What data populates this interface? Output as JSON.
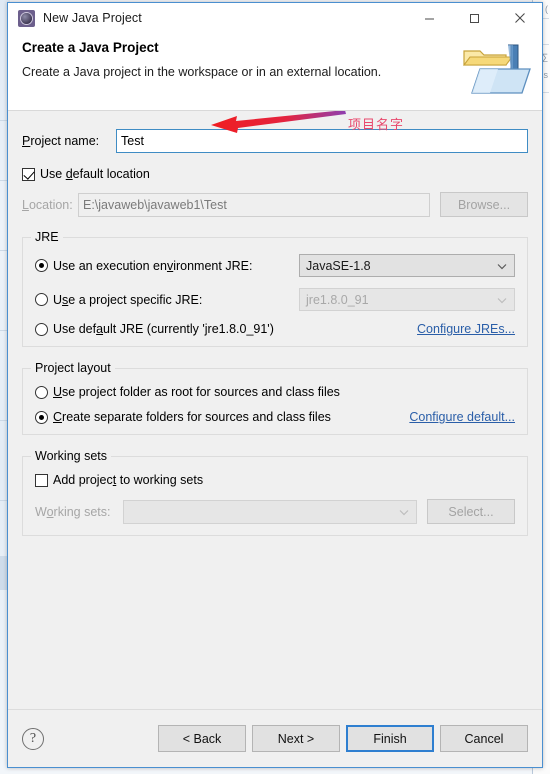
{
  "window": {
    "title": "New Java Project",
    "icon": "eclipse-wizard-icon",
    "minimize_label": "—",
    "maximize_label": "□",
    "close_label": "✕"
  },
  "header": {
    "title": "Create a Java Project",
    "subtitle": "Create a Java project in the workspace or in an external location.",
    "art_icon": "java-project-folder-icon"
  },
  "project_name": {
    "label": "Project name:",
    "value": "Test",
    "placeholder": ""
  },
  "location": {
    "use_default_label": "Use default location",
    "use_default_checked": true,
    "label": "Location:",
    "value": "E:\\javaweb\\javaweb1\\Test",
    "browse_label": "Browse...",
    "browse_enabled": false
  },
  "jre": {
    "group_title": "JRE",
    "options": [
      {
        "label": "Use an execution environment JRE:",
        "selected": true
      },
      {
        "label": "Use a project specific JRE:",
        "selected": false
      },
      {
        "label": "Use default JRE (currently 'jre1.8.0_91')",
        "selected": false
      }
    ],
    "execution_env_value": "JavaSE-1.8",
    "specific_jre_value": "jre1.8.0_91",
    "configure_link": "Configure JREs..."
  },
  "project_layout": {
    "group_title": "Project layout",
    "options": [
      {
        "label": "Use project folder as root for sources and class files",
        "selected": false
      },
      {
        "label": "Create separate folders for sources and class files",
        "selected": true
      }
    ],
    "configure_link": "Configure default..."
  },
  "working_sets": {
    "group_title": "Working sets",
    "add_label": "Add project to working sets",
    "add_checked": false,
    "label": "Working sets:",
    "value": "",
    "select_label": "Select...",
    "select_enabled": false
  },
  "footer": {
    "help_label": "?",
    "back_label": "< Back",
    "next_label": "Next >",
    "finish_label": "Finish",
    "cancel_label": "Cancel",
    "default_button": "Finish"
  },
  "annotation": {
    "text": "项目名字",
    "arrow": "left-pointing-arrow",
    "color": "#e8486d"
  }
}
